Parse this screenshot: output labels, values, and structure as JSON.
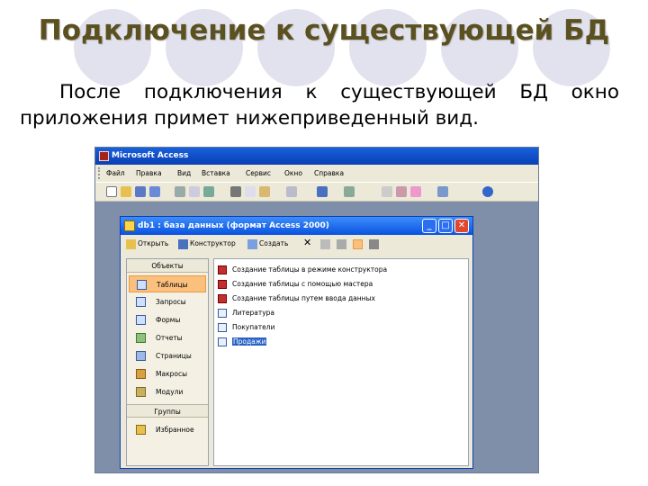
{
  "slide": {
    "title": "Подключение к существующей БД",
    "body": "После подключения к существующей БД окно приложения примет нижеприведенный вид."
  },
  "app": {
    "title": "Microsoft Access",
    "menu": [
      "Файл",
      "Правка",
      "Вид",
      "Вставка",
      "Сервис",
      "Окно",
      "Справка"
    ]
  },
  "db_window": {
    "title": "db1 : база данных (формат Access 2000)",
    "toolbar": {
      "open": "Открыть",
      "design": "Конструктор",
      "create": "Создать"
    },
    "objects_header": "Объекты",
    "objects": [
      "Таблицы",
      "Запросы",
      "Формы",
      "Отчеты",
      "Страницы",
      "Макросы",
      "Модули"
    ],
    "selected_object": "Таблицы",
    "groups_header": "Группы",
    "groups": [
      "Избранное"
    ],
    "list": [
      {
        "label": "Создание таблицы в режиме конструктора",
        "kind": "wizard"
      },
      {
        "label": "Создание таблицы с помощью мастера",
        "kind": "wizard"
      },
      {
        "label": "Создание таблицы путем ввода данных",
        "kind": "wizard"
      },
      {
        "label": "Литература",
        "kind": "table"
      },
      {
        "label": "Покупатели",
        "kind": "table"
      },
      {
        "label": "Продажи",
        "kind": "table",
        "selected": true
      }
    ]
  },
  "colors": {
    "title_text": "#5a5020",
    "xp_blue": "#0a52e0",
    "selected_orange": "#fcc07e",
    "decor_circle": "#e2e2ef"
  }
}
